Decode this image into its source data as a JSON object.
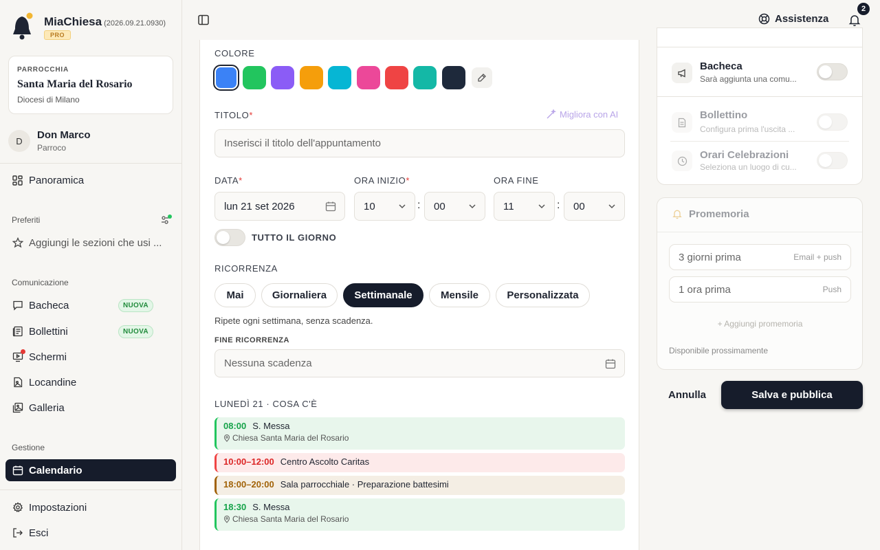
{
  "app": {
    "name": "MiaChiesa",
    "version": "(2026.09.21.0930)",
    "plan": "PRO"
  },
  "parish": {
    "label": "PARROCCHIA",
    "name": "Santa Maria del Rosario",
    "diocese": "Diocesi di Milano"
  },
  "user": {
    "initial": "D",
    "name": "Don Marco",
    "role": "Parroco"
  },
  "sidebar": {
    "overview": "Panoramica",
    "favorites_label": "Preferiti",
    "favorites_add": "Aggiungi le sezioni che usi ...",
    "comm_label": "Comunicazione",
    "comm_items": [
      {
        "label": "Bacheca",
        "badge": "NUOVA"
      },
      {
        "label": "Bollettini",
        "badge": "NUOVA"
      },
      {
        "label": "Schermi"
      },
      {
        "label": "Locandine"
      },
      {
        "label": "Galleria"
      }
    ],
    "mgmt_label": "Gestione",
    "calendar": "Calendario",
    "settings": "Impostazioni",
    "logout": "Esci"
  },
  "topbar": {
    "assist": "Assistenza",
    "notif_count": "2"
  },
  "form": {
    "color_label": "COLORE",
    "colors": [
      "#3b82f6",
      "#22c55e",
      "#8b5cf6",
      "#f59e0b",
      "#06b6d4",
      "#ec4899",
      "#ef4444",
      "#14b8a6",
      "#1e293b"
    ],
    "title_label": "TITOLO",
    "ai_link": "Migliora con AI",
    "title_placeholder": "Inserisci il titolo dell'appuntamento",
    "date_label": "DATA",
    "date_value": "lun 21 set 2026",
    "start_label": "ORA INIZIO",
    "start_h": "10",
    "start_m": "00",
    "end_label": "ORA FINE",
    "end_h": "11",
    "end_m": "00",
    "allday_label": "TUTTO IL GIORNO",
    "recur_label": "RICORRENZA",
    "recur_options": [
      "Mai",
      "Giornaliera",
      "Settimanale",
      "Mensile",
      "Personalizzata"
    ],
    "recur_selected": "Settimanale",
    "recur_helper": "Ripete ogni settimana, senza scadenza.",
    "recur_end_label": "FINE RICORRENZA",
    "recur_end_placeholder": "Nessuna scadenza",
    "day_header": "LUNEDÌ 21 · COSA C'È",
    "events": [
      {
        "time": "08:00",
        "title": "S. Messa",
        "location": "Chiesa Santa Maria del Rosario",
        "color": "#22c55e",
        "bg": "#e8f6ec"
      },
      {
        "time": "10:00–12:00",
        "title": "Centro Ascolto Caritas",
        "location": "",
        "color": "#ef4444",
        "bg": "#fdeaea"
      },
      {
        "time": "18:00–20:00",
        "title": "Sala parrocchiale · Preparazione battesimi",
        "location": "",
        "color": "#a16207",
        "bg": "#f4eee4"
      },
      {
        "time": "18:30",
        "title": "S. Messa",
        "location": "Chiesa Santa Maria del Rosario",
        "color": "#22c55e",
        "bg": "#e8f6ec"
      }
    ]
  },
  "publish": {
    "bacheca_title": "Bacheca",
    "bacheca_sub": "Sarà aggiunta una comu...",
    "bollettino_title": "Bollettino",
    "bollettino_sub": "Configura prima l'uscita ...",
    "orari_title": "Orari Celebrazioni",
    "orari_sub": "Seleziona un luogo di cu..."
  },
  "reminders": {
    "title": "Promemoria",
    "items": [
      {
        "label": "3 giorni prima",
        "channel": "Email + push"
      },
      {
        "label": "1 ora prima",
        "channel": "Push"
      }
    ],
    "add": "+ Aggiungi promemoria",
    "note": "Disponibile prossimamente"
  },
  "actions": {
    "cancel": "Annulla",
    "save": "Salva e pubblica"
  }
}
